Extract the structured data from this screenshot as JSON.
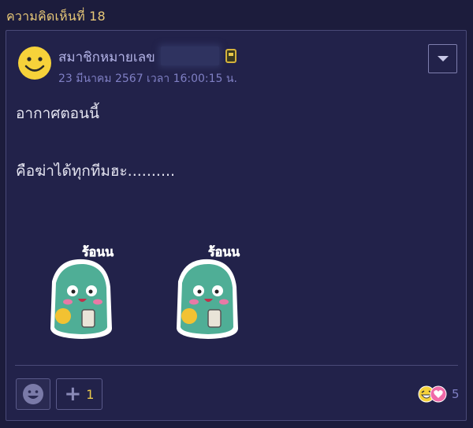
{
  "comment": {
    "header_label": "ความคิดเห็นที่ 18",
    "author_name": "สมาชิกหมายเลข",
    "timestamp": "23 มีนาคม 2567 เวลา 16:00:15 น.",
    "body_line1": "อากาศตอนนี้",
    "body_line2": "คือฆ่าได้ทุกทีมฮะ..........",
    "sticker_text": "ร้อนน",
    "plus_count": "1",
    "reaction_count": "5"
  },
  "colors": {
    "background": "#1c1c3c",
    "card": "#22224a",
    "header_text": "#e8c878",
    "username": "#b3b3e6",
    "timestamp": "#7f7fc4",
    "accent_yellow": "#e8c84a"
  },
  "icons": [
    "smiley-avatar-icon",
    "member-badge-icon",
    "dropdown-caret-icon",
    "emoji-face-icon",
    "plus-icon",
    "laugh-reaction-icon",
    "love-reaction-icon"
  ]
}
